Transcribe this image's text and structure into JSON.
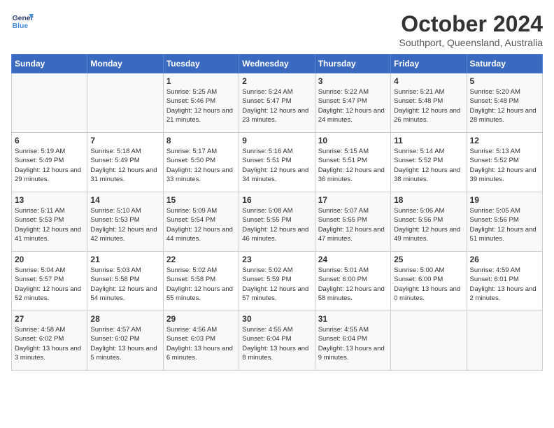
{
  "header": {
    "logo_line1": "General",
    "logo_line2": "Blue",
    "month": "October 2024",
    "location": "Southport, Queensland, Australia"
  },
  "weekdays": [
    "Sunday",
    "Monday",
    "Tuesday",
    "Wednesday",
    "Thursday",
    "Friday",
    "Saturday"
  ],
  "weeks": [
    [
      {
        "day": "",
        "sunrise": "",
        "sunset": "",
        "daylight": ""
      },
      {
        "day": "",
        "sunrise": "",
        "sunset": "",
        "daylight": ""
      },
      {
        "day": "1",
        "sunrise": "Sunrise: 5:25 AM",
        "sunset": "Sunset: 5:46 PM",
        "daylight": "Daylight: 12 hours and 21 minutes."
      },
      {
        "day": "2",
        "sunrise": "Sunrise: 5:24 AM",
        "sunset": "Sunset: 5:47 PM",
        "daylight": "Daylight: 12 hours and 23 minutes."
      },
      {
        "day": "3",
        "sunrise": "Sunrise: 5:22 AM",
        "sunset": "Sunset: 5:47 PM",
        "daylight": "Daylight: 12 hours and 24 minutes."
      },
      {
        "day": "4",
        "sunrise": "Sunrise: 5:21 AM",
        "sunset": "Sunset: 5:48 PM",
        "daylight": "Daylight: 12 hours and 26 minutes."
      },
      {
        "day": "5",
        "sunrise": "Sunrise: 5:20 AM",
        "sunset": "Sunset: 5:48 PM",
        "daylight": "Daylight: 12 hours and 28 minutes."
      }
    ],
    [
      {
        "day": "6",
        "sunrise": "Sunrise: 5:19 AM",
        "sunset": "Sunset: 5:49 PM",
        "daylight": "Daylight: 12 hours and 29 minutes."
      },
      {
        "day": "7",
        "sunrise": "Sunrise: 5:18 AM",
        "sunset": "Sunset: 5:49 PM",
        "daylight": "Daylight: 12 hours and 31 minutes."
      },
      {
        "day": "8",
        "sunrise": "Sunrise: 5:17 AM",
        "sunset": "Sunset: 5:50 PM",
        "daylight": "Daylight: 12 hours and 33 minutes."
      },
      {
        "day": "9",
        "sunrise": "Sunrise: 5:16 AM",
        "sunset": "Sunset: 5:51 PM",
        "daylight": "Daylight: 12 hours and 34 minutes."
      },
      {
        "day": "10",
        "sunrise": "Sunrise: 5:15 AM",
        "sunset": "Sunset: 5:51 PM",
        "daylight": "Daylight: 12 hours and 36 minutes."
      },
      {
        "day": "11",
        "sunrise": "Sunrise: 5:14 AM",
        "sunset": "Sunset: 5:52 PM",
        "daylight": "Daylight: 12 hours and 38 minutes."
      },
      {
        "day": "12",
        "sunrise": "Sunrise: 5:13 AM",
        "sunset": "Sunset: 5:52 PM",
        "daylight": "Daylight: 12 hours and 39 minutes."
      }
    ],
    [
      {
        "day": "13",
        "sunrise": "Sunrise: 5:11 AM",
        "sunset": "Sunset: 5:53 PM",
        "daylight": "Daylight: 12 hours and 41 minutes."
      },
      {
        "day": "14",
        "sunrise": "Sunrise: 5:10 AM",
        "sunset": "Sunset: 5:53 PM",
        "daylight": "Daylight: 12 hours and 42 minutes."
      },
      {
        "day": "15",
        "sunrise": "Sunrise: 5:09 AM",
        "sunset": "Sunset: 5:54 PM",
        "daylight": "Daylight: 12 hours and 44 minutes."
      },
      {
        "day": "16",
        "sunrise": "Sunrise: 5:08 AM",
        "sunset": "Sunset: 5:55 PM",
        "daylight": "Daylight: 12 hours and 46 minutes."
      },
      {
        "day": "17",
        "sunrise": "Sunrise: 5:07 AM",
        "sunset": "Sunset: 5:55 PM",
        "daylight": "Daylight: 12 hours and 47 minutes."
      },
      {
        "day": "18",
        "sunrise": "Sunrise: 5:06 AM",
        "sunset": "Sunset: 5:56 PM",
        "daylight": "Daylight: 12 hours and 49 minutes."
      },
      {
        "day": "19",
        "sunrise": "Sunrise: 5:05 AM",
        "sunset": "Sunset: 5:56 PM",
        "daylight": "Daylight: 12 hours and 51 minutes."
      }
    ],
    [
      {
        "day": "20",
        "sunrise": "Sunrise: 5:04 AM",
        "sunset": "Sunset: 5:57 PM",
        "daylight": "Daylight: 12 hours and 52 minutes."
      },
      {
        "day": "21",
        "sunrise": "Sunrise: 5:03 AM",
        "sunset": "Sunset: 5:58 PM",
        "daylight": "Daylight: 12 hours and 54 minutes."
      },
      {
        "day": "22",
        "sunrise": "Sunrise: 5:02 AM",
        "sunset": "Sunset: 5:58 PM",
        "daylight": "Daylight: 12 hours and 55 minutes."
      },
      {
        "day": "23",
        "sunrise": "Sunrise: 5:02 AM",
        "sunset": "Sunset: 5:59 PM",
        "daylight": "Daylight: 12 hours and 57 minutes."
      },
      {
        "day": "24",
        "sunrise": "Sunrise: 5:01 AM",
        "sunset": "Sunset: 6:00 PM",
        "daylight": "Daylight: 12 hours and 58 minutes."
      },
      {
        "day": "25",
        "sunrise": "Sunrise: 5:00 AM",
        "sunset": "Sunset: 6:00 PM",
        "daylight": "Daylight: 13 hours and 0 minutes."
      },
      {
        "day": "26",
        "sunrise": "Sunrise: 4:59 AM",
        "sunset": "Sunset: 6:01 PM",
        "daylight": "Daylight: 13 hours and 2 minutes."
      }
    ],
    [
      {
        "day": "27",
        "sunrise": "Sunrise: 4:58 AM",
        "sunset": "Sunset: 6:02 PM",
        "daylight": "Daylight: 13 hours and 3 minutes."
      },
      {
        "day": "28",
        "sunrise": "Sunrise: 4:57 AM",
        "sunset": "Sunset: 6:02 PM",
        "daylight": "Daylight: 13 hours and 5 minutes."
      },
      {
        "day": "29",
        "sunrise": "Sunrise: 4:56 AM",
        "sunset": "Sunset: 6:03 PM",
        "daylight": "Daylight: 13 hours and 6 minutes."
      },
      {
        "day": "30",
        "sunrise": "Sunrise: 4:55 AM",
        "sunset": "Sunset: 6:04 PM",
        "daylight": "Daylight: 13 hours and 8 minutes."
      },
      {
        "day": "31",
        "sunrise": "Sunrise: 4:55 AM",
        "sunset": "Sunset: 6:04 PM",
        "daylight": "Daylight: 13 hours and 9 minutes."
      },
      {
        "day": "",
        "sunrise": "",
        "sunset": "",
        "daylight": ""
      },
      {
        "day": "",
        "sunrise": "",
        "sunset": "",
        "daylight": ""
      }
    ]
  ]
}
